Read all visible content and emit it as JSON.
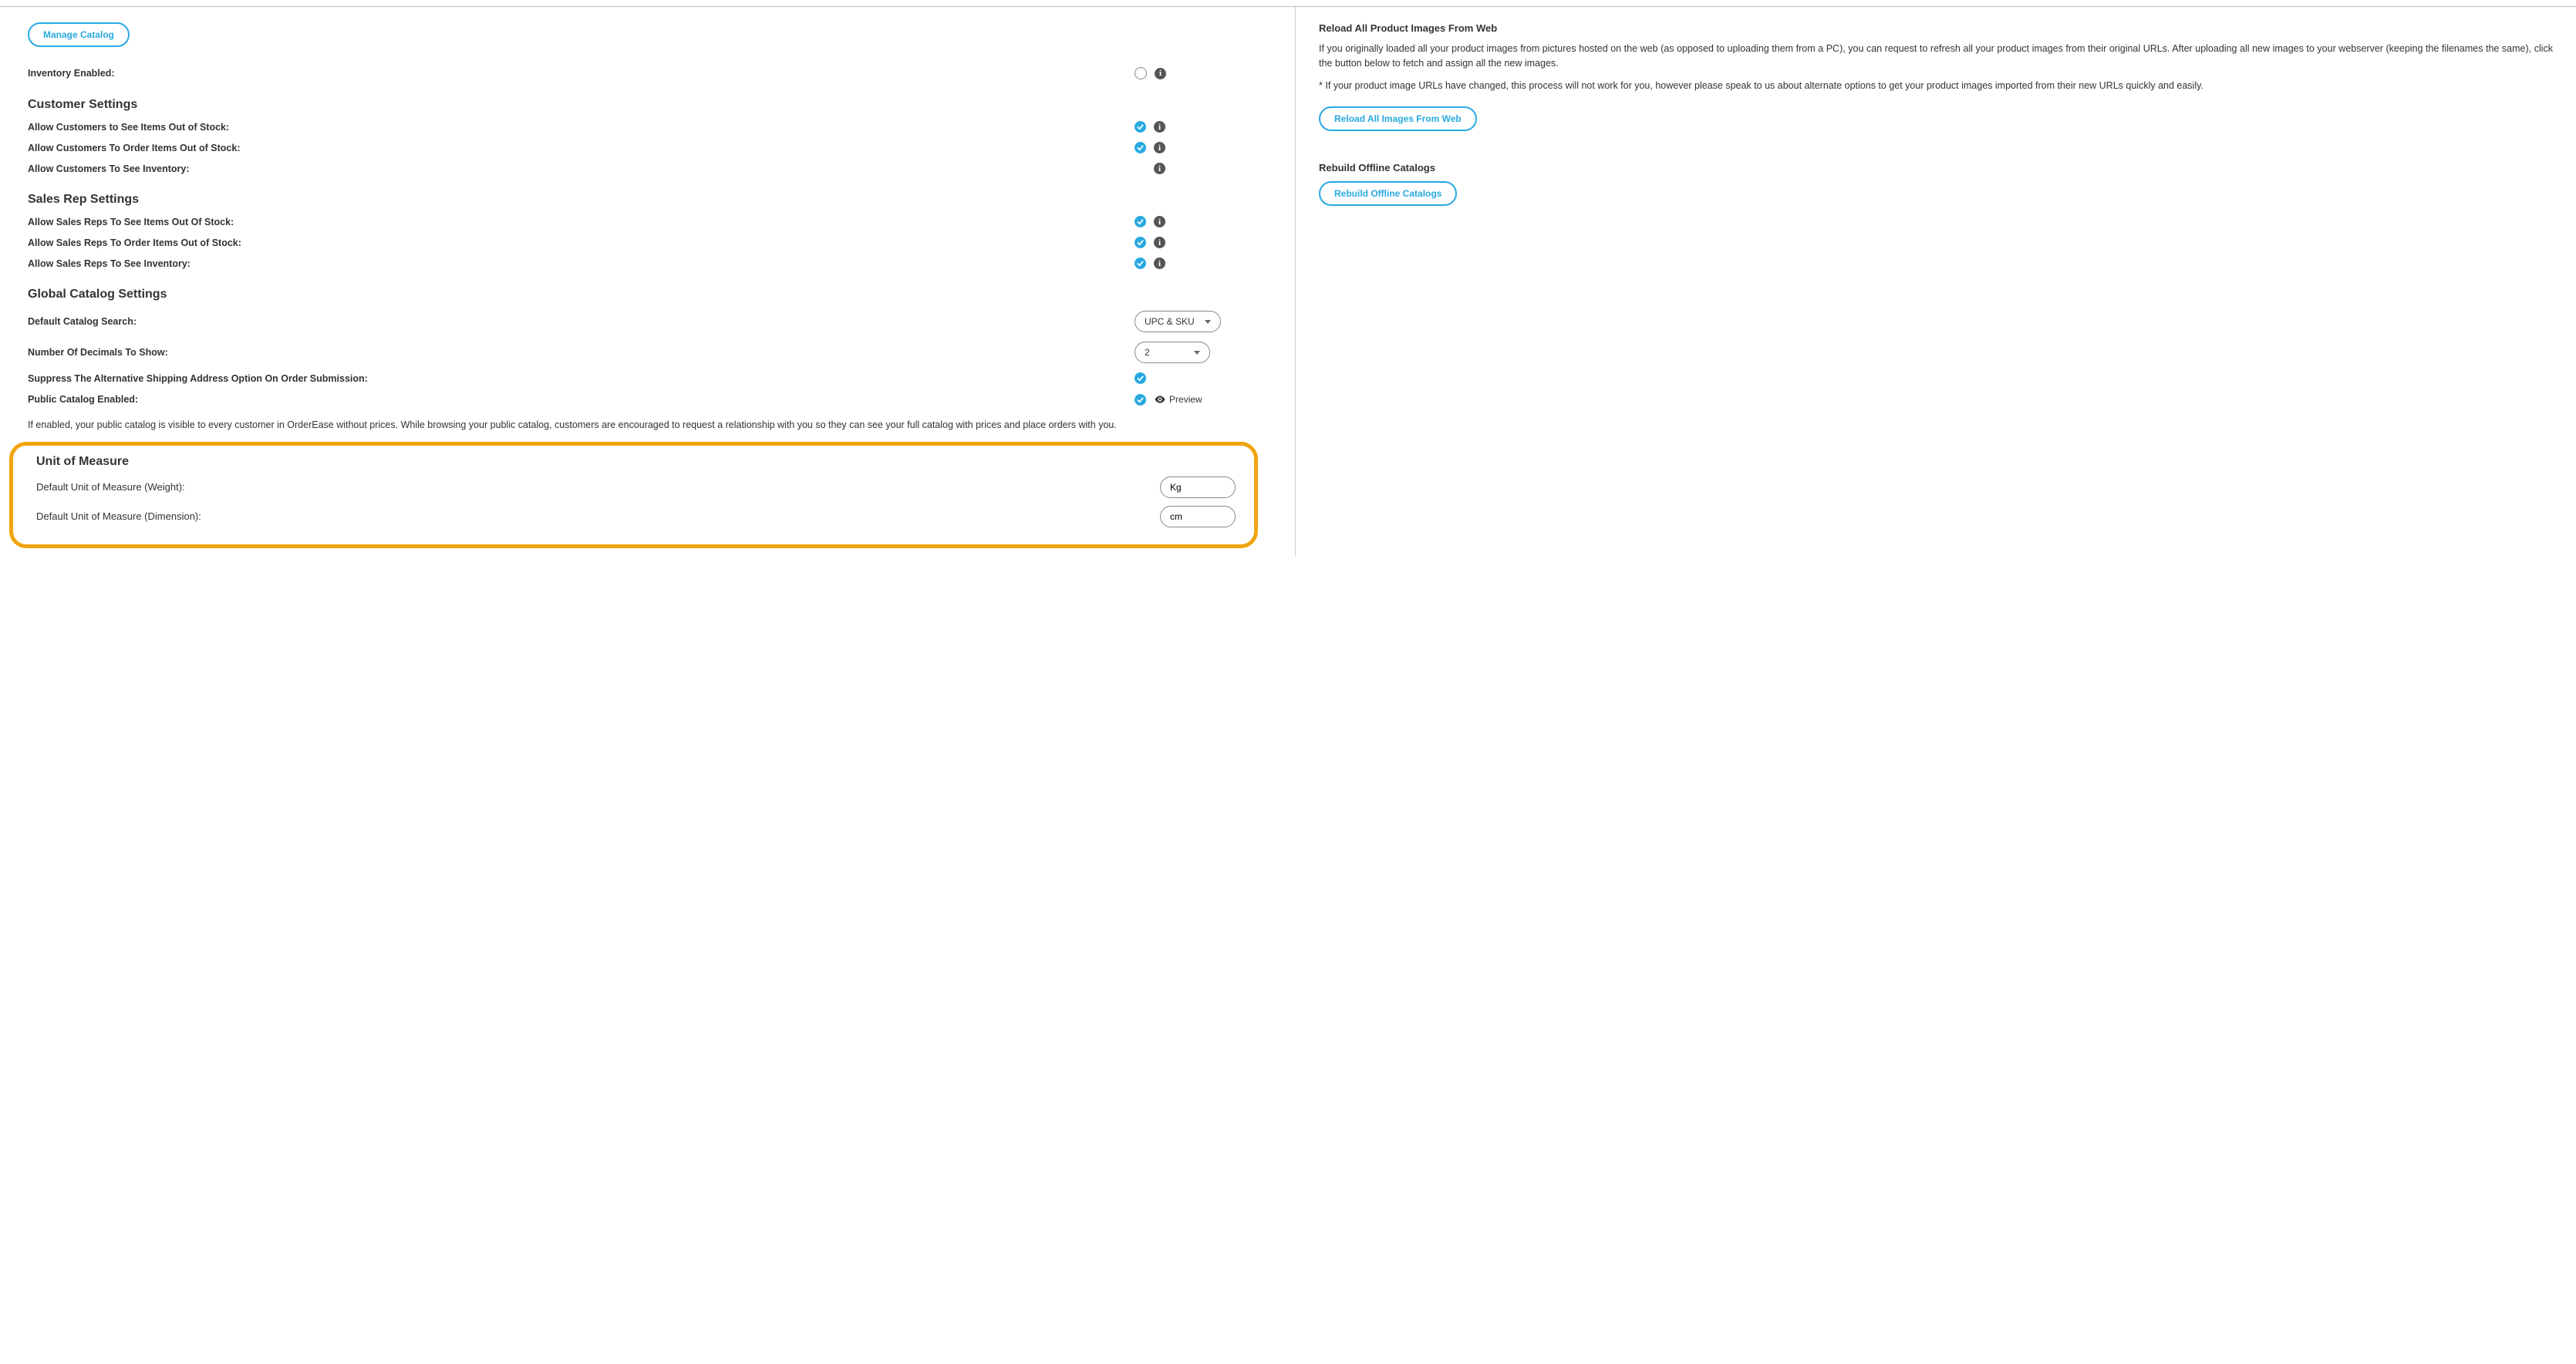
{
  "manage_catalog_btn": "Manage Catalog",
  "inventory_enabled_label": "Inventory Enabled:",
  "sections": {
    "customer": {
      "title": "Customer Settings",
      "see_out": "Allow Customers to See Items Out of Stock:",
      "order_out": "Allow Customers To Order Items Out of Stock:",
      "see_inv": "Allow Customers To See Inventory:"
    },
    "salesrep": {
      "title": "Sales Rep Settings",
      "see_out": "Allow Sales Reps To See Items Out Of Stock:",
      "order_out": "Allow Sales Reps To Order Items Out of Stock:",
      "see_inv": "Allow Sales Reps To See Inventory:"
    },
    "global": {
      "title": "Global Catalog Settings",
      "default_search": "Default Catalog Search:",
      "default_search_value": "UPC & SKU",
      "decimals": "Number Of Decimals To Show:",
      "decimals_value": "2",
      "suppress": "Suppress The Alternative Shipping Address Option On Order Submission:",
      "public_enabled": "Public Catalog Enabled:",
      "preview": "Preview",
      "public_catalog_desc": "If enabled, your public catalog is visible to every customer in OrderEase without prices. While browsing your public catalog, customers are encouraged to request a relationship with you so they can see your full catalog with prices and place orders with you."
    },
    "uom": {
      "title": "Unit of Measure",
      "weight_label": "Default Unit of Measure (Weight):",
      "weight_value": "Kg",
      "dim_label": "Default Unit of Measure (Dimension):",
      "dim_value": "cm"
    }
  },
  "right": {
    "reload_title": "Reload All Product Images From Web",
    "reload_p1": "If you originally loaded all your product images from pictures hosted on the web (as opposed to uploading them from a PC), you can request to refresh all your product images from their original URLs. After uploading all new images to your webserver (keeping the filenames the same), click the button below to fetch and assign all the new images.",
    "reload_p2": "* If your product image URLs have changed, this process will not work for you, however please speak to us about alternate options to get your product images imported from their new URLs quickly and easily.",
    "reload_btn": "Reload All Images From Web",
    "rebuild_title": "Rebuild Offline Catalogs",
    "rebuild_btn": "Rebuild Offline Catalogs"
  }
}
